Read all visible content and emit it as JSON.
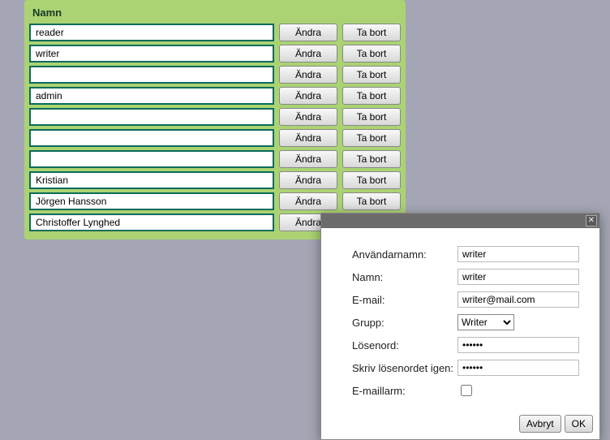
{
  "table": {
    "header": "Namn",
    "edit_label": "Ändra",
    "delete_label": "Ta bort",
    "rows": [
      {
        "name": "reader"
      },
      {
        "name": "writer"
      },
      {
        "name": ""
      },
      {
        "name": "admin"
      },
      {
        "name": ""
      },
      {
        "name": ""
      },
      {
        "name": ""
      },
      {
        "name": "Kristian"
      },
      {
        "name": "Jörgen Hansson"
      },
      {
        "name": "Christoffer Lynghed"
      }
    ]
  },
  "modal": {
    "close_glyph": "✕",
    "labels": {
      "username": "Användarnamn:",
      "name": "Namn:",
      "email": "E-mail:",
      "group": "Grupp:",
      "password": "Lösenord:",
      "password2": "Skriv lösenordet igen:",
      "email_alarm": "E-maillarm:"
    },
    "values": {
      "username": "writer",
      "name": "writer",
      "email": "writer@mail.com",
      "group": "Writer",
      "password": "••••••",
      "password2": "••••••",
      "email_alarm": false
    },
    "group_options": [
      "Writer"
    ],
    "buttons": {
      "cancel": "Avbryt",
      "ok": "OK"
    }
  }
}
